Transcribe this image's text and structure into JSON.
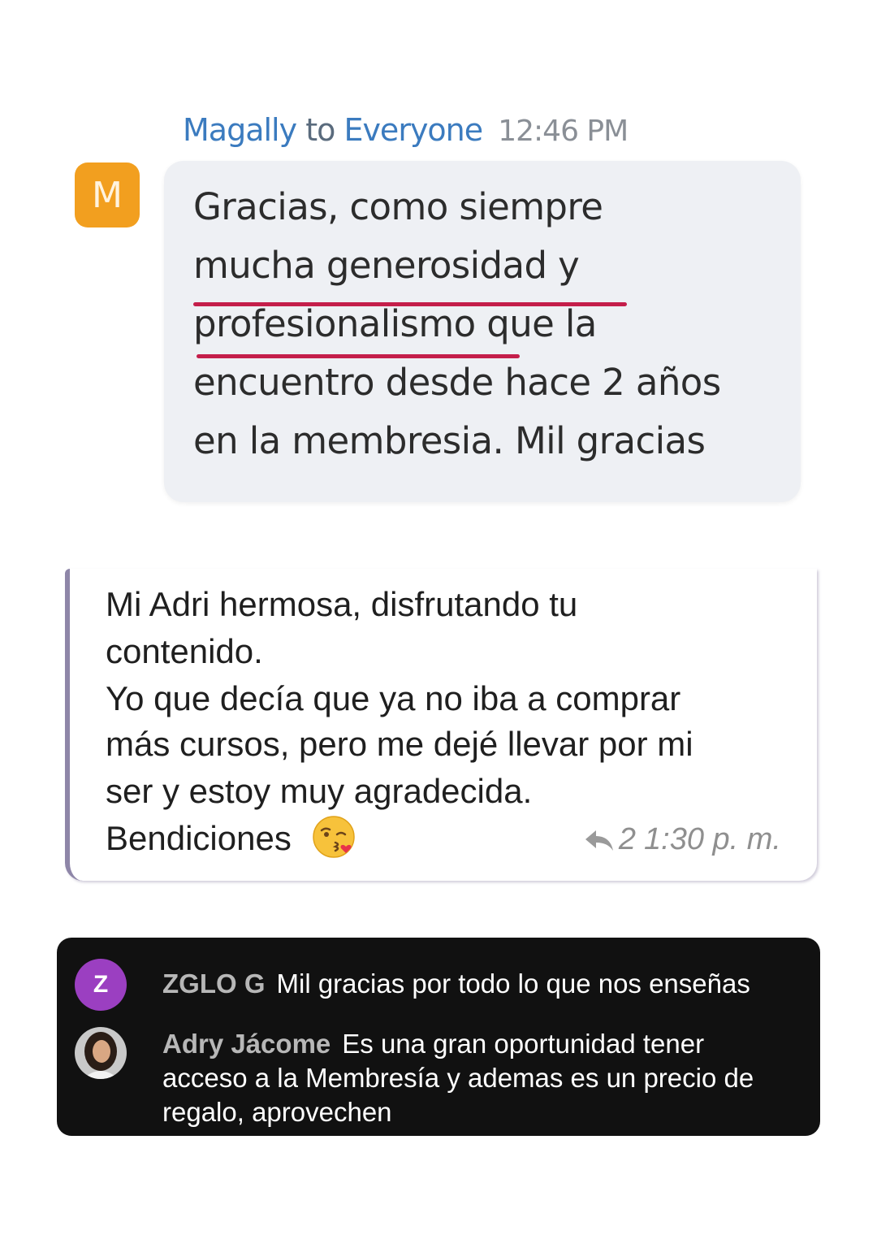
{
  "zoom_chat": {
    "sender": "Magally",
    "to_word": "to",
    "recipient": "Everyone",
    "time": "12:46 PM",
    "avatar_initial": "M",
    "message_lines": [
      "Gracias, como siempre",
      "mucha generosidad y",
      "profesionalismo que la",
      "encuentro desde hace 2 años",
      "en la membresia. Mil gracias"
    ],
    "underline_color": "#c41e4a"
  },
  "whatsapp_message": {
    "lines": [
      "Mi Adri hermosa, disfrutando tu",
      "contenido.",
      "Yo que decía que ya no iba a comprar",
      "más cursos, pero me dejé llevar por mi",
      "ser y estoy muy agradecida.",
      "Bendiciones"
    ],
    "emoji": "kissing-face-with-heart-emoji",
    "reply_count": "2",
    "time": "1:30 p. m."
  },
  "live_chat": {
    "messages": [
      {
        "avatar_initial": "Z",
        "avatar_color": "#9b3fc1",
        "author": "ZGLO G",
        "text": "Mil gracias por todo lo que nos enseñas"
      },
      {
        "avatar": "profile-photo",
        "author": "Adry Jácome",
        "text_lines": [
          "Es una gran oportunidad tener",
          "acceso a la Membresía y ademas es un precio de",
          "regalo, aprovechen"
        ]
      }
    ]
  }
}
